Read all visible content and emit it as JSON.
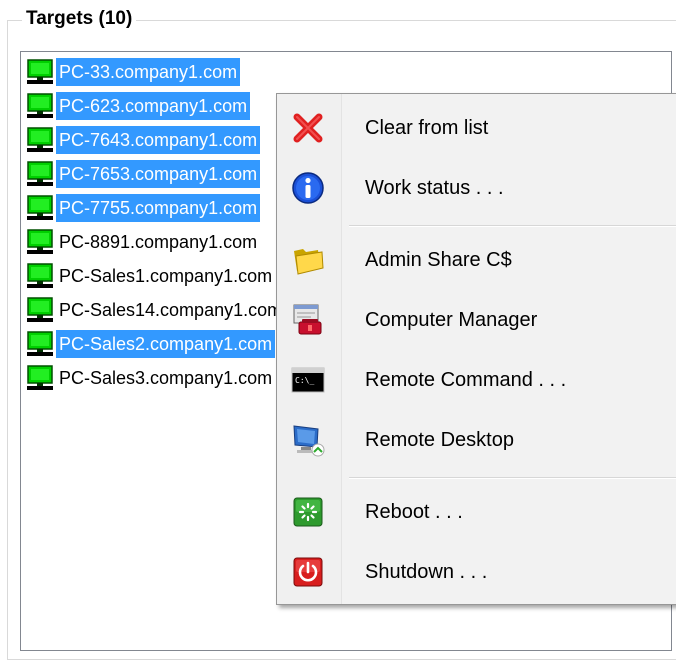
{
  "group": {
    "title": "Targets (10)"
  },
  "targets": [
    {
      "name": "PC-33.company1.com",
      "selected": true
    },
    {
      "name": "PC-623.company1.com",
      "selected": true
    },
    {
      "name": "PC-7643.company1.com",
      "selected": true
    },
    {
      "name": "PC-7653.company1.com",
      "selected": true
    },
    {
      "name": "PC-7755.company1.com",
      "selected": true
    },
    {
      "name": "PC-8891.company1.com",
      "selected": false
    },
    {
      "name": "PC-Sales1.company1.com",
      "selected": false
    },
    {
      "name": "PC-Sales14.company1.com",
      "selected": false
    },
    {
      "name": "PC-Sales2.company1.com",
      "selected": true
    },
    {
      "name": "PC-Sales3.company1.com",
      "selected": false
    }
  ],
  "context_menu": {
    "items": [
      {
        "label": "Clear from list",
        "icon": "red-x-icon"
      },
      {
        "label": "Work status . . .",
        "icon": "info-icon"
      },
      {
        "label": "Admin Share C$",
        "icon": "folder-icon"
      },
      {
        "label": "Computer Manager",
        "icon": "computer-management-icon"
      },
      {
        "label": "Remote Command . . .",
        "icon": "command-prompt-icon"
      },
      {
        "label": "Remote Desktop",
        "icon": "remote-desktop-icon"
      },
      {
        "label": "Reboot . . .",
        "icon": "reboot-icon"
      },
      {
        "label": "Shutdown . . .",
        "icon": "shutdown-icon"
      }
    ]
  },
  "colors": {
    "selection": "#3399ff",
    "menu_background": "#f2f2f2"
  }
}
